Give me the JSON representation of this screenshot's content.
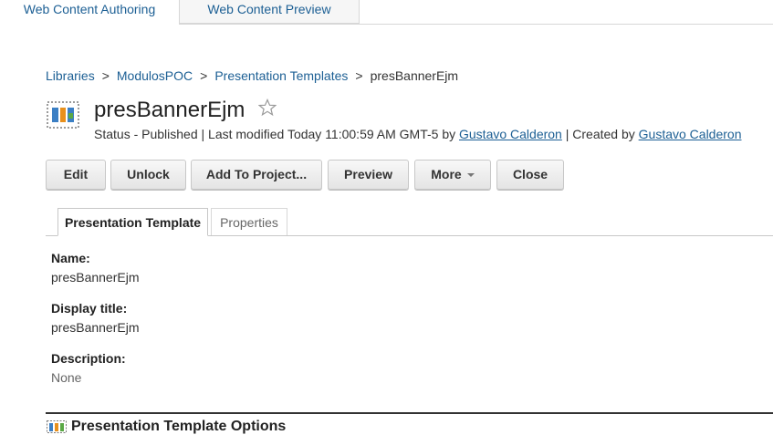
{
  "top_tabs": [
    {
      "label": "Web Content Authoring"
    },
    {
      "label": "Web Content Preview"
    }
  ],
  "breadcrumb": {
    "items": [
      "Libraries",
      "ModulosPOC",
      "Presentation Templates"
    ],
    "current": "presBannerEjm",
    "separator": ">"
  },
  "header": {
    "title": "presBannerEjm",
    "icon": "presentation-template-icon",
    "favorite_icon": "star-outline-icon",
    "status_text": "Status - Published | Last modified Today 11:00:59 AM GMT-5 by ",
    "modified_by": "Gustavo Calderon",
    "created_text": " | Created by ",
    "created_by": "Gustavo Calderon"
  },
  "actions": {
    "edit": "Edit",
    "unlock": "Unlock",
    "add_to_project": "Add To Project...",
    "preview": "Preview",
    "more": "More",
    "close": "Close"
  },
  "content_tabs": [
    {
      "label": "Presentation Template",
      "active": true
    },
    {
      "label": "Properties",
      "active": false
    }
  ],
  "fields": [
    {
      "label": "Name:",
      "value": "presBannerEjm"
    },
    {
      "label": "Display title:",
      "value": "presBannerEjm"
    },
    {
      "label": "Description:",
      "value": "None"
    }
  ],
  "section": {
    "title": "Presentation Template Options"
  },
  "colors": {
    "link": "#1c5f94",
    "accent_icon_blue": "#3b7fc4",
    "accent_icon_orange": "#e8901c",
    "accent_icon_green": "#5aa845"
  }
}
